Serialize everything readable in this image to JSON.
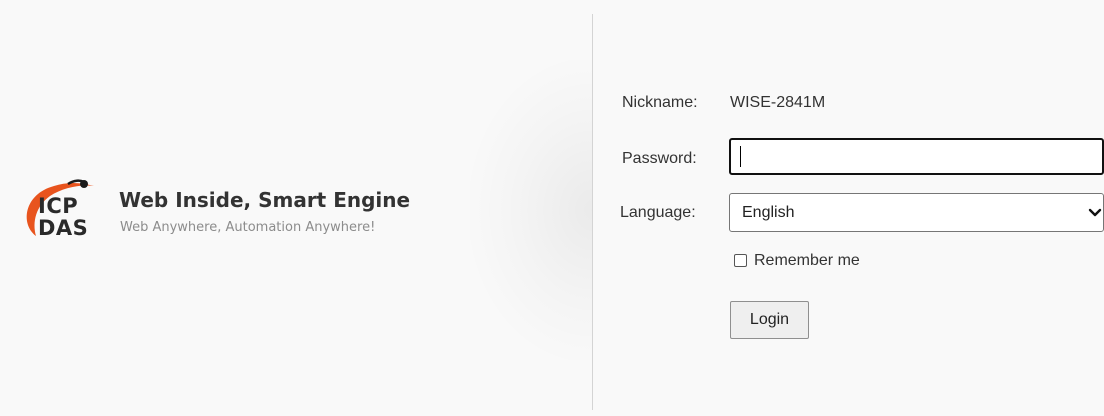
{
  "brand": {
    "logo_line1": "ICP",
    "logo_line2": "DAS",
    "tagline": "Web Inside, Smart Engine",
    "subtagline": "Web Anywhere, Automation Anywhere!",
    "logo_accent_color": "#e8541e",
    "logo_text_color": "#2a2a2a"
  },
  "form": {
    "nickname_label": "Nickname:",
    "nickname_value": "WISE-2841M",
    "password_label": "Password:",
    "password_value": "",
    "language_label": "Language:",
    "language_selected": "English",
    "remember_label": "Remember me",
    "remember_checked": false,
    "login_label": "Login"
  },
  "icons": {
    "language_dropdown": "chevron-down-icon",
    "logo": "icp-das-logo-icon"
  }
}
